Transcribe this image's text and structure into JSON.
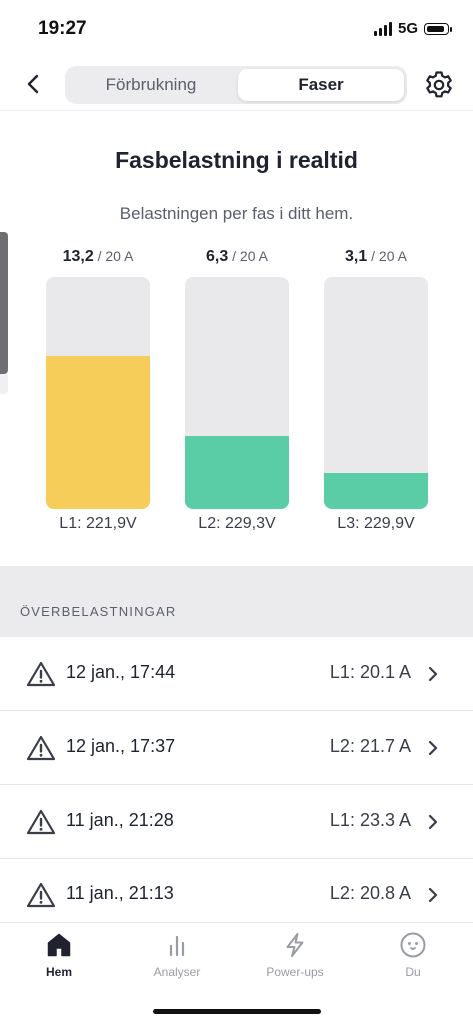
{
  "status": {
    "time": "19:27",
    "network": "5G"
  },
  "nav": {
    "back_icon": "chevron-left-icon",
    "tabs": [
      {
        "label": "Förbrukning",
        "selected": false
      },
      {
        "label": "Faser",
        "selected": true
      }
    ],
    "settings_icon": "gear-icon"
  },
  "header": {
    "title": "Fasbelastning i realtid",
    "subtitle": "Belastningen per fas i ditt hem."
  },
  "phases": [
    {
      "value": "13,2",
      "max": "/ 20 A",
      "fraction": 0.66,
      "color": "#f7cd59",
      "voltage": "L1: 221,9V"
    },
    {
      "value": "6,3",
      "max": "/ 20 A",
      "fraction": 0.315,
      "color": "#5acca6",
      "voltage": "L2: 229,3V"
    },
    {
      "value": "3,1",
      "max": "/ 20 A",
      "fraction": 0.155,
      "color": "#5acca6",
      "voltage": "L3: 229,9V"
    }
  ],
  "overloads": {
    "heading": "ÖVERBELASTNINGAR",
    "items": [
      {
        "date": "12 jan., 17:44",
        "value": "L1: 20.1 A"
      },
      {
        "date": "12 jan., 17:37",
        "value": "L2: 21.7 A"
      },
      {
        "date": "11 jan., 21:28",
        "value": "L1: 23.3 A"
      },
      {
        "date": "11 jan., 21:13",
        "value": "L2: 20.8 A"
      }
    ]
  },
  "tabbar": [
    {
      "label": "Hem",
      "icon": "home-icon",
      "active": true
    },
    {
      "label": "Analyser",
      "icon": "bar-chart-icon",
      "active": false
    },
    {
      "label": "Power-ups",
      "icon": "lightning-icon",
      "active": false
    },
    {
      "label": "Du",
      "icon": "profile-face-icon",
      "active": false
    }
  ]
}
